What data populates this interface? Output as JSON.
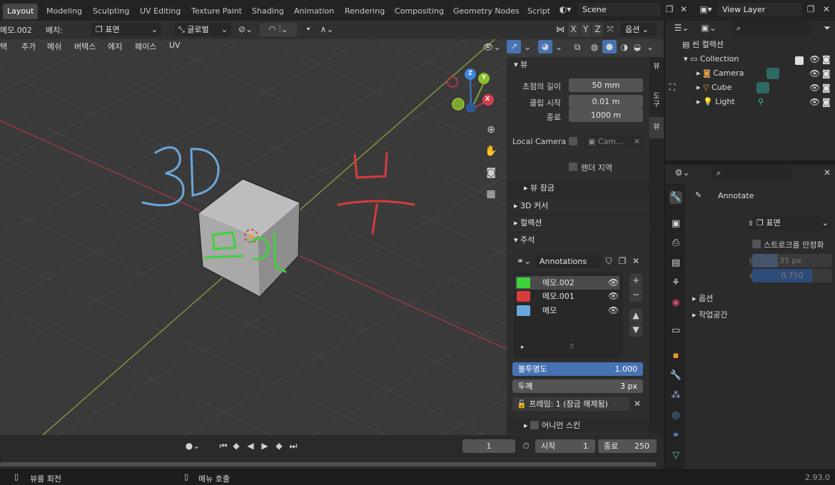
{
  "workspace_tabs": [
    "Layout",
    "Modeling",
    "Sculpting",
    "UV Editing",
    "Texture Paint",
    "Shading",
    "Animation",
    "Rendering",
    "Compositing",
    "Geometry Nodes",
    "Script"
  ],
  "scene": {
    "name": "Scene"
  },
  "view_layer": {
    "name": "View Layer"
  },
  "viewport_header": {
    "layer_name": "메모.002",
    "placement_label": "배치:",
    "placement_value": "표면",
    "orientation": "글로벌",
    "axes": [
      "X",
      "Y",
      "Z"
    ],
    "options": "옵션"
  },
  "viewport_menus": [
    "택",
    "추가",
    "메쉬",
    "버텍스",
    "에지",
    "페이스",
    "UV"
  ],
  "annotations_drawn": {
    "label_3d": "3D",
    "label_view": "뷰",
    "label_face": "표면"
  },
  "navigation_gizmo": {
    "x": "X",
    "y": "Y",
    "z": "Z"
  },
  "npanel": {
    "view_header": "뷰",
    "focal_label": "초점의 길이",
    "focal_value": "50 mm",
    "clip_start_label": "클립 시작",
    "clip_start_value": "0.01 m",
    "clip_end_label": "종료",
    "clip_end_value": "1000 m",
    "local_camera_label": "Local Camera",
    "local_camera_value": "Cam...",
    "render_region_label": "렌더 지역",
    "view_lock": "뷰 잠금",
    "cursor_3d": "3D 커서",
    "collections": "컬렉션",
    "annotations_header": "주석",
    "annotations_datablock": "Annotations",
    "layers": [
      {
        "name": "메모.002",
        "color": "#3ed33a"
      },
      {
        "name": "메모.001",
        "color": "#d83b3b"
      },
      {
        "name": "메모",
        "color": "#6aa7da"
      }
    ],
    "opacity_label": "불투명도",
    "opacity_value": "1.000",
    "thickness_label": "두께",
    "thickness_value": "3 px",
    "frame_label": "프레임: 1 (잠금 해제됨)",
    "onion_skin": "어니언 스킨"
  },
  "npanel_tabs": [
    "뷰",
    "도구",
    "뷰"
  ],
  "timeline": {
    "current_frame": "1",
    "start_label": "시작",
    "start_value": "1",
    "end_label": "종료",
    "end_value": "250"
  },
  "statusbar": {
    "left_hint": "뷰를 회전",
    "mid_hint": "메뉴 호출",
    "version": "2.93.0"
  },
  "outliner": {
    "header": "씬 컬렉션",
    "items": [
      {
        "name": "Collection"
      },
      {
        "name": "Camera"
      },
      {
        "name": "Cube"
      },
      {
        "name": "Light"
      }
    ]
  },
  "properties": {
    "tool_name": "Annotate",
    "placement_label": "배치",
    "placement_value": "표면",
    "stabilize_label": "스트로크를 안정화",
    "radius_label": "반경",
    "radius_value": "35 px",
    "factor_label": "팩터",
    "factor_value": "0.750",
    "options": "옵션",
    "workspace": "작업공간"
  },
  "colors": {
    "accent_blue": "#4772b3",
    "x_axis": "#b53541",
    "y_axis": "#7ea52c",
    "z_axis": "#3b79c9"
  }
}
